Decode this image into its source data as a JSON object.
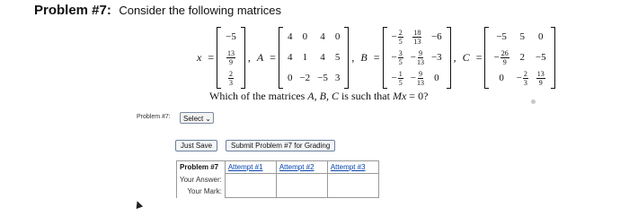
{
  "problem": {
    "title": "Problem #7:",
    "statement": "Consider the following matrices",
    "question_pre": "Which of the matrices ",
    "question_vars": "A, B, C",
    "question_mid": " is such that ",
    "question_expr": "Mx",
    "question_post": " = 0?"
  },
  "matrices": {
    "x_name": "x",
    "x": [
      [
        "-5"
      ],
      [
        "13/9"
      ],
      [
        "2/3"
      ]
    ],
    "a_name": "A",
    "a": [
      [
        "4",
        "0",
        "4",
        "0"
      ],
      [
        "4",
        "1",
        "4",
        "5"
      ],
      [
        "0",
        "-2",
        "-5",
        "3"
      ]
    ],
    "b_name": "B",
    "b": [
      [
        "-2/5",
        "18/13",
        "-6"
      ],
      [
        "-3/5",
        "-9/13",
        "-3"
      ],
      [
        "-1/5",
        "-9/13",
        "0"
      ]
    ],
    "c_name": "C",
    "c": [
      [
        "-5",
        "5",
        "0"
      ],
      [
        "-26/9",
        "2",
        "-5"
      ],
      [
        "0",
        "-2/3",
        "13/9"
      ]
    ]
  },
  "answer": {
    "label": "Problem #7:",
    "select_value": "Select",
    "chevron_icon": "chevron-down-icon"
  },
  "buttons": {
    "save": "Just Save",
    "submit": "Submit Problem #7 for Grading"
  },
  "attempts_table": {
    "header": "Problem #7",
    "your_answer": "Your Answer:",
    "your_mark": "Your Mark:",
    "attempts": [
      "Attempt #1",
      "Attempt #2",
      "Attempt #3"
    ]
  }
}
